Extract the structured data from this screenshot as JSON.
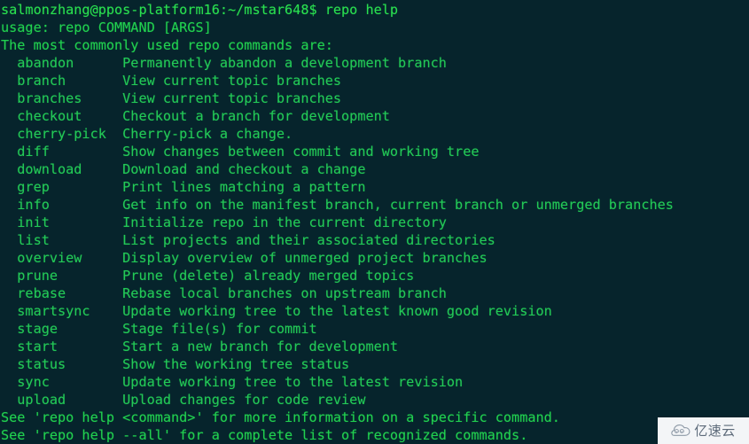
{
  "terminal": {
    "background_color": "#06242c",
    "text_color": "#21d14f",
    "prompt_color": "#2ae04f",
    "prompt_line": "salmonzhang@ppos-platform16:~/mstar648$ repo help",
    "usage_line": "usage: repo COMMAND [ARGS]",
    "heading_line": "The most commonly used repo commands are:",
    "commands": [
      {
        "line": "  abandon      Permanently abandon a development branch"
      },
      {
        "line": "  branch       View current topic branches"
      },
      {
        "line": "  branches     View current topic branches"
      },
      {
        "line": "  checkout     Checkout a branch for development"
      },
      {
        "line": "  cherry-pick  Cherry-pick a change."
      },
      {
        "line": "  diff         Show changes between commit and working tree"
      },
      {
        "line": "  download     Download and checkout a change"
      },
      {
        "line": "  grep         Print lines matching a pattern"
      },
      {
        "line": "  info         Get info on the manifest branch, current branch or unmerged branches"
      },
      {
        "line": "  init         Initialize repo in the current directory"
      },
      {
        "line": "  list         List projects and their associated directories"
      },
      {
        "line": "  overview     Display overview of unmerged project branches"
      },
      {
        "line": "  prune        Prune (delete) already merged topics"
      },
      {
        "line": "  rebase       Rebase local branches on upstream branch"
      },
      {
        "line": "  smartsync    Update working tree to the latest known good revision"
      },
      {
        "line": "  stage        Stage file(s) for commit"
      },
      {
        "line": "  start        Start a new branch for development"
      },
      {
        "line": "  status       Show the working tree status"
      },
      {
        "line": "  sync         Update working tree to the latest revision"
      },
      {
        "line": "  upload       Upload changes for code review"
      }
    ],
    "footer_lines": [
      {
        "line": "See 'repo help <command>' for more information on a specific command."
      },
      {
        "line": "See 'repo help --all' for a complete list of recognized commands."
      }
    ]
  },
  "watermark": {
    "text": "亿速云",
    "icon": "cloud-icon",
    "background_color": "#f3f5f7",
    "text_color": "#5d6b7a"
  }
}
